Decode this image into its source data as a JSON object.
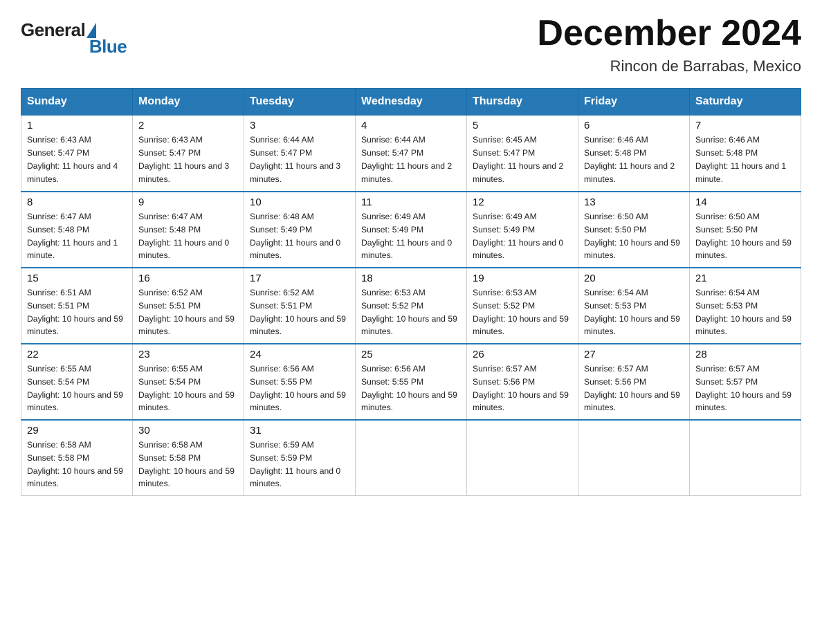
{
  "logo": {
    "general": "General",
    "blue": "Blue"
  },
  "title": "December 2024",
  "subtitle": "Rincon de Barrabas, Mexico",
  "days_of_week": [
    "Sunday",
    "Monday",
    "Tuesday",
    "Wednesday",
    "Thursday",
    "Friday",
    "Saturday"
  ],
  "weeks": [
    [
      {
        "day": "1",
        "sunrise": "6:43 AM",
        "sunset": "5:47 PM",
        "daylight": "11 hours and 4 minutes."
      },
      {
        "day": "2",
        "sunrise": "6:43 AM",
        "sunset": "5:47 PM",
        "daylight": "11 hours and 3 minutes."
      },
      {
        "day": "3",
        "sunrise": "6:44 AM",
        "sunset": "5:47 PM",
        "daylight": "11 hours and 3 minutes."
      },
      {
        "day": "4",
        "sunrise": "6:44 AM",
        "sunset": "5:47 PM",
        "daylight": "11 hours and 2 minutes."
      },
      {
        "day": "5",
        "sunrise": "6:45 AM",
        "sunset": "5:47 PM",
        "daylight": "11 hours and 2 minutes."
      },
      {
        "day": "6",
        "sunrise": "6:46 AM",
        "sunset": "5:48 PM",
        "daylight": "11 hours and 2 minutes."
      },
      {
        "day": "7",
        "sunrise": "6:46 AM",
        "sunset": "5:48 PM",
        "daylight": "11 hours and 1 minute."
      }
    ],
    [
      {
        "day": "8",
        "sunrise": "6:47 AM",
        "sunset": "5:48 PM",
        "daylight": "11 hours and 1 minute."
      },
      {
        "day": "9",
        "sunrise": "6:47 AM",
        "sunset": "5:48 PM",
        "daylight": "11 hours and 0 minutes."
      },
      {
        "day": "10",
        "sunrise": "6:48 AM",
        "sunset": "5:49 PM",
        "daylight": "11 hours and 0 minutes."
      },
      {
        "day": "11",
        "sunrise": "6:49 AM",
        "sunset": "5:49 PM",
        "daylight": "11 hours and 0 minutes."
      },
      {
        "day": "12",
        "sunrise": "6:49 AM",
        "sunset": "5:49 PM",
        "daylight": "11 hours and 0 minutes."
      },
      {
        "day": "13",
        "sunrise": "6:50 AM",
        "sunset": "5:50 PM",
        "daylight": "10 hours and 59 minutes."
      },
      {
        "day": "14",
        "sunrise": "6:50 AM",
        "sunset": "5:50 PM",
        "daylight": "10 hours and 59 minutes."
      }
    ],
    [
      {
        "day": "15",
        "sunrise": "6:51 AM",
        "sunset": "5:51 PM",
        "daylight": "10 hours and 59 minutes."
      },
      {
        "day": "16",
        "sunrise": "6:52 AM",
        "sunset": "5:51 PM",
        "daylight": "10 hours and 59 minutes."
      },
      {
        "day": "17",
        "sunrise": "6:52 AM",
        "sunset": "5:51 PM",
        "daylight": "10 hours and 59 minutes."
      },
      {
        "day": "18",
        "sunrise": "6:53 AM",
        "sunset": "5:52 PM",
        "daylight": "10 hours and 59 minutes."
      },
      {
        "day": "19",
        "sunrise": "6:53 AM",
        "sunset": "5:52 PM",
        "daylight": "10 hours and 59 minutes."
      },
      {
        "day": "20",
        "sunrise": "6:54 AM",
        "sunset": "5:53 PM",
        "daylight": "10 hours and 59 minutes."
      },
      {
        "day": "21",
        "sunrise": "6:54 AM",
        "sunset": "5:53 PM",
        "daylight": "10 hours and 59 minutes."
      }
    ],
    [
      {
        "day": "22",
        "sunrise": "6:55 AM",
        "sunset": "5:54 PM",
        "daylight": "10 hours and 59 minutes."
      },
      {
        "day": "23",
        "sunrise": "6:55 AM",
        "sunset": "5:54 PM",
        "daylight": "10 hours and 59 minutes."
      },
      {
        "day": "24",
        "sunrise": "6:56 AM",
        "sunset": "5:55 PM",
        "daylight": "10 hours and 59 minutes."
      },
      {
        "day": "25",
        "sunrise": "6:56 AM",
        "sunset": "5:55 PM",
        "daylight": "10 hours and 59 minutes."
      },
      {
        "day": "26",
        "sunrise": "6:57 AM",
        "sunset": "5:56 PM",
        "daylight": "10 hours and 59 minutes."
      },
      {
        "day": "27",
        "sunrise": "6:57 AM",
        "sunset": "5:56 PM",
        "daylight": "10 hours and 59 minutes."
      },
      {
        "day": "28",
        "sunrise": "6:57 AM",
        "sunset": "5:57 PM",
        "daylight": "10 hours and 59 minutes."
      }
    ],
    [
      {
        "day": "29",
        "sunrise": "6:58 AM",
        "sunset": "5:58 PM",
        "daylight": "10 hours and 59 minutes."
      },
      {
        "day": "30",
        "sunrise": "6:58 AM",
        "sunset": "5:58 PM",
        "daylight": "10 hours and 59 minutes."
      },
      {
        "day": "31",
        "sunrise": "6:59 AM",
        "sunset": "5:59 PM",
        "daylight": "11 hours and 0 minutes."
      },
      null,
      null,
      null,
      null
    ]
  ],
  "labels": {
    "sunrise_prefix": "Sunrise: ",
    "sunset_prefix": "Sunset: ",
    "daylight_prefix": "Daylight: "
  }
}
